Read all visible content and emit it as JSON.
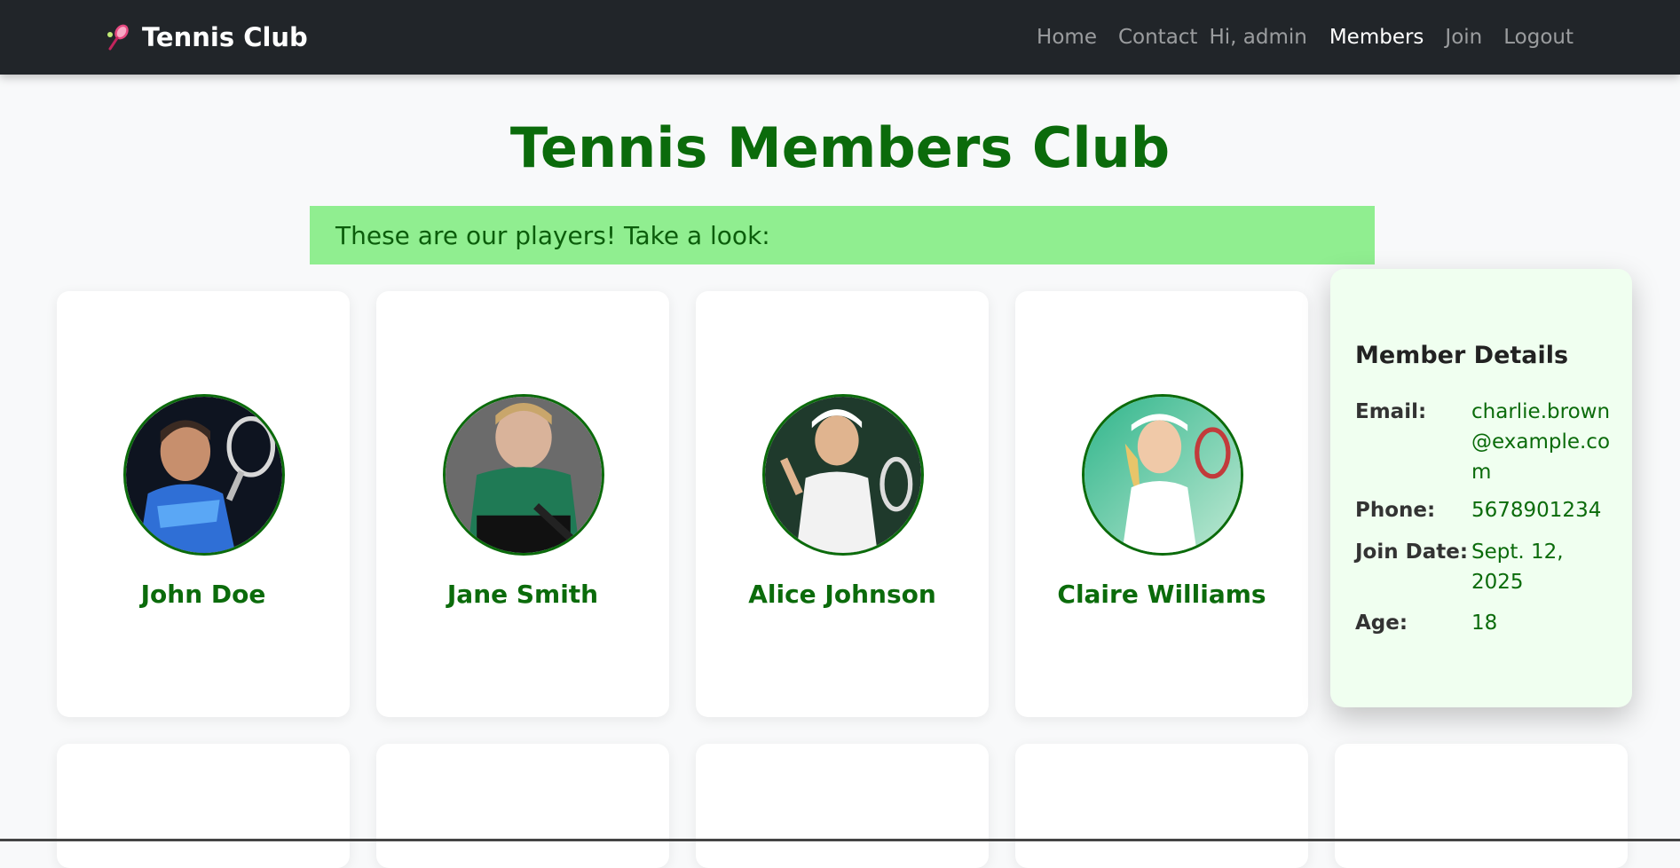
{
  "navbar": {
    "brand": "Tennis Club",
    "brand_icon": "tennis-racket-icon",
    "links": {
      "home": "Home",
      "contact": "Contact",
      "greeting": "Hi, admin",
      "members": "Members",
      "join": "Join",
      "logout": "Logout"
    },
    "active": "Members"
  },
  "main": {
    "title": "Tennis Members Club",
    "banner": "These are our players! Take a look:"
  },
  "members": [
    {
      "name": "John Doe"
    },
    {
      "name": "Jane Smith"
    },
    {
      "name": "Alice Johnson"
    },
    {
      "name": "Claire Williams"
    }
  ],
  "details": {
    "heading": "Member Details",
    "email_label": "Email:",
    "email": "charlie.brown@example.com",
    "phone_label": "Phone:",
    "phone": "5678901234",
    "join_label": "Join Date:",
    "join_date": "Sept. 12, 2025",
    "age_label": "Age:",
    "age": "18"
  },
  "colors": {
    "navbar": "#212529",
    "accent_green": "#0b6b0b",
    "banner_bg": "#90ee90",
    "details_bg": "#f0fff0"
  }
}
